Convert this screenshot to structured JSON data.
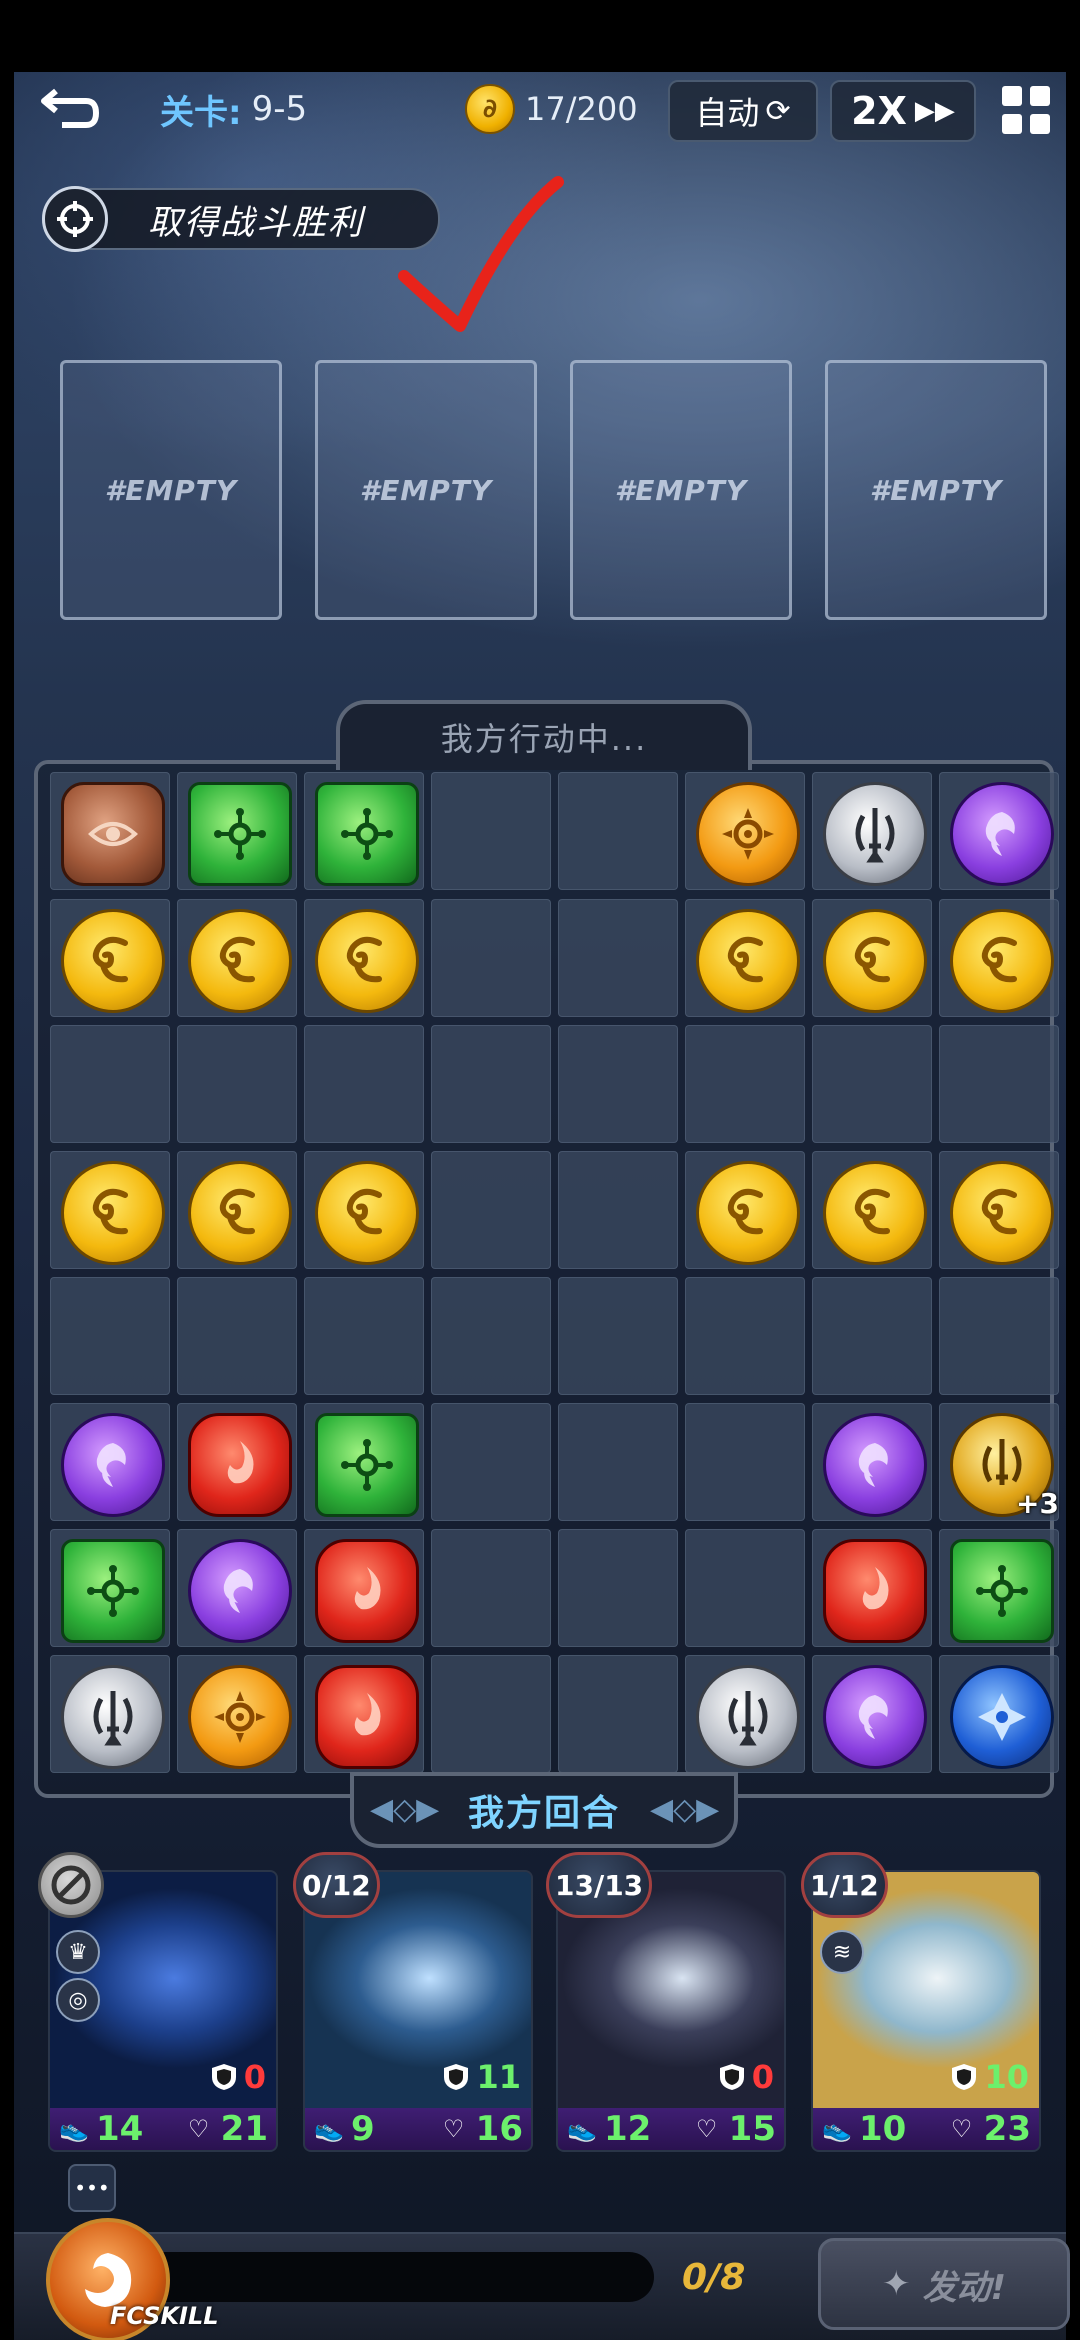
{
  "hud": {
    "level_key": "关卡:",
    "level_value": "9-5",
    "coins": "17/200",
    "auto_label": "自动",
    "speed_label": "2X"
  },
  "objective": {
    "text": "取得战斗胜利"
  },
  "slots": [
    "#EMPTY",
    "#EMPTY",
    "#EMPTY",
    "#EMPTY"
  ],
  "board": {
    "status": "我方行动中...",
    "turn_banner": "我方回合",
    "rows": [
      [
        "brown",
        "green",
        "green",
        "",
        "",
        "orange",
        "silver",
        "purple"
      ],
      [
        "yellow",
        "yellow",
        "yellow",
        "",
        "",
        "yellow",
        "yellow",
        "yellow"
      ],
      [
        "",
        "",
        "",
        "",
        "",
        "",
        "",
        ""
      ],
      [
        "yellow",
        "yellow",
        "yellow",
        "",
        "",
        "yellow",
        "yellow",
        "yellow"
      ],
      [
        "",
        "",
        "",
        "",
        "",
        "",
        "",
        ""
      ],
      [
        "purple",
        "red",
        "green",
        "",
        "",
        "",
        "purple",
        "goldsword+3"
      ],
      [
        "green",
        "purple",
        "red",
        "",
        "",
        "",
        "red",
        "green"
      ],
      [
        "silver",
        "orange",
        "red",
        "",
        "",
        "silver",
        "purple",
        "blue"
      ]
    ]
  },
  "cards": [
    {
      "charge": "",
      "shield": "0",
      "shield_color": "#ff3b3b",
      "speed": "14",
      "hp": "21",
      "art": [
        "#1c3f8a",
        "#4b7be0",
        "#0c1d44"
      ]
    },
    {
      "charge": "0/12",
      "shield": "11",
      "shield_color": "#6cf06c",
      "speed": "9",
      "hp": "16",
      "art": [
        "#2d5c8f",
        "#bfe0ff",
        "#163352"
      ]
    },
    {
      "charge": "13/13",
      "shield": "0",
      "shield_color": "#ff3b3b",
      "speed": "12",
      "hp": "15",
      "art": [
        "#3b3f5a",
        "#d9e4f2",
        "#1f2236"
      ]
    },
    {
      "charge": "1/12",
      "shield": "10",
      "shield_color": "#6cf06c",
      "speed": "10",
      "hp": "23",
      "art": [
        "#8fb7cc",
        "#eef4f7",
        "#c9a34a"
      ]
    }
  ],
  "skill": {
    "label": "FCSKILL",
    "count": "0/8",
    "launch_label": "发动!"
  },
  "colors": {
    "accent_blue": "#6fc6ff",
    "gold": "#e8b73a",
    "stat_green": "#6cf06c",
    "annotation_red": "#e8231a"
  }
}
